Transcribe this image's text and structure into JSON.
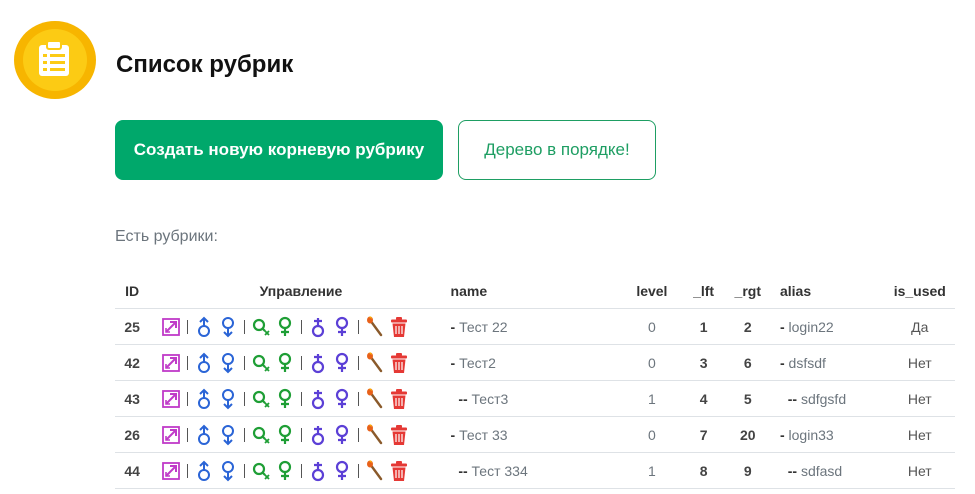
{
  "header": {
    "title": "Список рубрик",
    "logo_icon": "clipboard-list-icon"
  },
  "actions": {
    "create_root": "Создать новую корневую рубрику",
    "tree_status": "Дерево в порядке!"
  },
  "section_label": "Есть рубрики:",
  "colors": {
    "primary": "#00a86b",
    "logo": "#fccb14",
    "purple": "#c03bc8",
    "blue": "#2a64d6",
    "green": "#1e9e35",
    "violet": "#5b3fd6",
    "red": "#e53935"
  },
  "table": {
    "headers": {
      "id": "ID",
      "manage": "Управление",
      "name": "name",
      "level": "level",
      "lft": "_lft",
      "rgt": "_rgt",
      "alias": "alias",
      "is_used": "is_used"
    },
    "action_icons": [
      "move-icon",
      "male-up-icon",
      "female-down-icon",
      "search-remove-icon",
      "female-green-icon",
      "male-violet-icon",
      "female-violet-icon",
      "match-icon",
      "trash-icon"
    ],
    "rows": [
      {
        "id": "25",
        "name_prefix": "-",
        "name": " Тест 22",
        "level": "0",
        "lft": "1",
        "rgt": "2",
        "alias_prefix": "-",
        "alias": " login22",
        "is_used": "Да"
      },
      {
        "id": "42",
        "name_prefix": "-",
        "name": " Тест2",
        "level": "0",
        "lft": "3",
        "rgt": "6",
        "alias_prefix": "-",
        "alias": " dsfsdf",
        "is_used": "Нет"
      },
      {
        "id": "43",
        "name_prefix": "  --",
        "name": " Тест3",
        "level": "1",
        "lft": "4",
        "rgt": "5",
        "alias_prefix": "  --",
        "alias": " sdfgsfd",
        "is_used": "Нет"
      },
      {
        "id": "26",
        "name_prefix": "-",
        "name": " Тест 33",
        "level": "0",
        "lft": "7",
        "rgt": "20",
        "alias_prefix": "-",
        "alias": " login33",
        "is_used": "Нет"
      },
      {
        "id": "44",
        "name_prefix": "  --",
        "name": " Тест 334",
        "level": "1",
        "lft": "8",
        "rgt": "9",
        "alias_prefix": "  --",
        "alias": " sdfasd",
        "is_used": "Нет"
      }
    ]
  }
}
